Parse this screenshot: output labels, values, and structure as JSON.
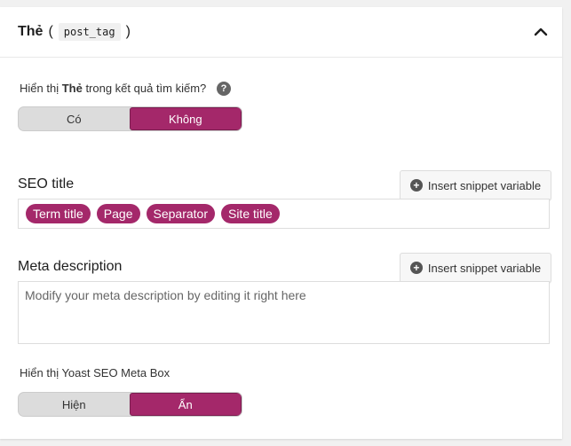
{
  "header": {
    "taxonomy_label": "Thẻ",
    "open_paren": "(",
    "taxonomy_slug": "post_tag",
    "close_paren": ")"
  },
  "search_visibility": {
    "label_prefix": "Hiển thị ",
    "label_bold": "Thẻ",
    "label_suffix": " trong kết quả tìm kiếm?",
    "help_glyph": "?",
    "options": [
      "Có",
      "Không"
    ],
    "selected": "Không"
  },
  "seo_title": {
    "label": "SEO title",
    "insert_button": "Insert snippet variable",
    "variables": [
      "Term title",
      "Page",
      "Separator",
      "Site title"
    ]
  },
  "meta_description": {
    "label": "Meta description",
    "insert_button": "Insert snippet variable",
    "placeholder": "Modify your meta description by editing it right here"
  },
  "meta_box": {
    "label": "Hiển thị Yoast SEO Meta Box",
    "options": [
      "Hiện",
      "Ẩn"
    ],
    "selected": "Ẩn"
  },
  "colors": {
    "accent": "#a4286a",
    "toggle_inactive": "#dcdcdc"
  },
  "icons": {
    "collapse": "chevron-up-icon",
    "help": "question-circle-icon",
    "insert": "plus-circle-icon"
  }
}
